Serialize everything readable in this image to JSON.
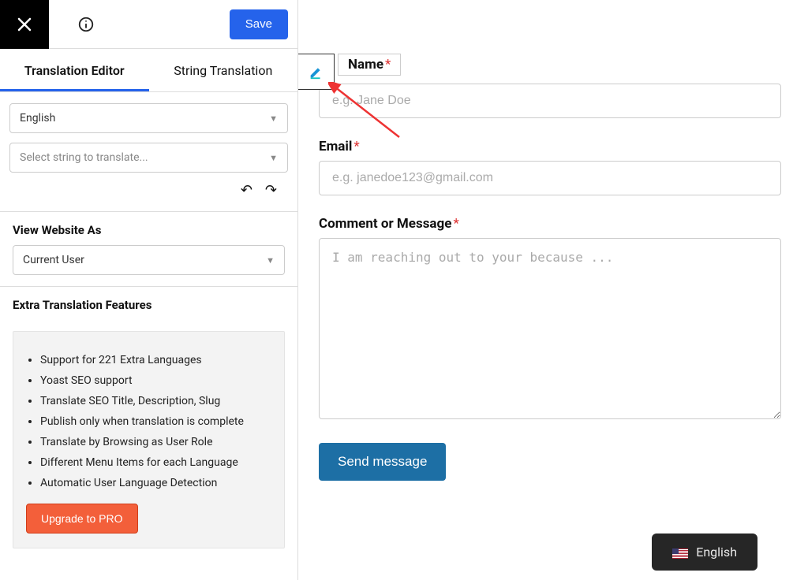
{
  "topbar": {
    "save_label": "Save"
  },
  "tabs": {
    "editor": "Translation Editor",
    "strings": "String Translation"
  },
  "language_select": {
    "value": "English"
  },
  "string_select": {
    "placeholder": "Select string to translate..."
  },
  "view_as": {
    "heading": "View Website As",
    "value": "Current User"
  },
  "extra": {
    "heading": "Extra Translation Features",
    "items": [
      "Support for 221 Extra Languages",
      "Yoast SEO support",
      "Translate SEO Title, Description, Slug",
      "Publish only when translation is complete",
      "Translate by Browsing as User Role",
      "Different Menu Items for each Language",
      "Automatic User Language Detection"
    ],
    "upgrade_label": "Upgrade to PRO"
  },
  "form": {
    "name_label": "Name",
    "name_placeholder": "e.g. Jane Doe",
    "email_label": "Email",
    "email_placeholder": "e.g. janedoe123@gmail.com",
    "comment_label": "Comment or Message",
    "comment_placeholder": "I am reaching out to your because ...",
    "submit_label": "Send message"
  },
  "lang_widget": {
    "label": "English"
  }
}
